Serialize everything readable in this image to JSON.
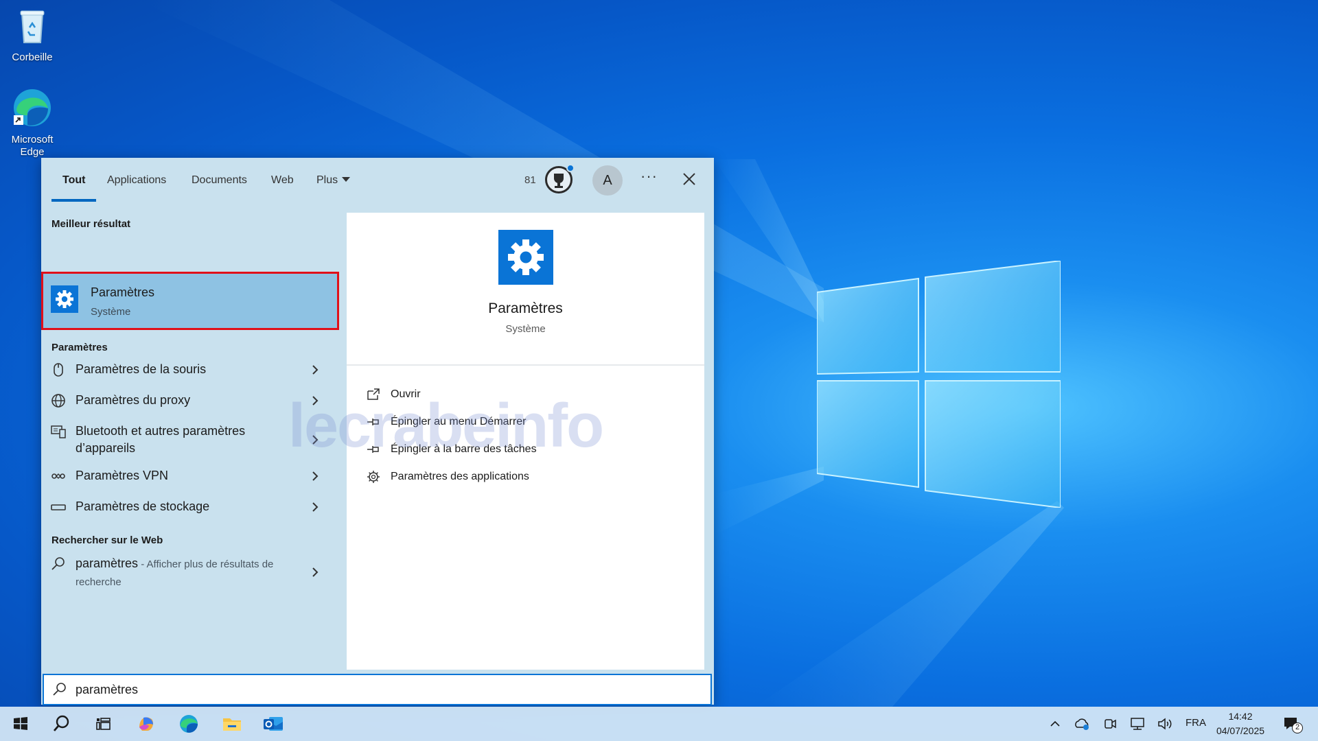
{
  "desktop": {
    "icons": [
      {
        "label": "Corbeille"
      },
      {
        "label": "Microsoft Edge"
      }
    ]
  },
  "search_panel": {
    "tabs": [
      "Tout",
      "Applications",
      "Documents",
      "Web",
      "Plus"
    ],
    "points": "81",
    "avatar_letter": "A",
    "more_label": "···",
    "best_match": {
      "section_title": "Meilleur résultat",
      "name": "Paramètres",
      "subtitle": "Système",
      "highlighted": true,
      "highlight_color": "#e0101a"
    },
    "settings_section": {
      "title": "Paramètres",
      "items": [
        {
          "label": "Paramètres de la souris",
          "icon": "mouse-icon"
        },
        {
          "label": "Paramètres du proxy",
          "icon": "globe-icon"
        },
        {
          "label": "Bluetooth et autres paramètres d’appareils",
          "icon": "devices-icon"
        },
        {
          "label": "Paramètres VPN",
          "icon": "vpn-icon"
        },
        {
          "label": "Paramètres de stockage",
          "icon": "storage-icon"
        }
      ]
    },
    "web_section": {
      "title": "Rechercher sur le Web",
      "query": "paramètres",
      "suffix": " - Afficher plus de résultats de recherche"
    },
    "preview": {
      "name": "Paramètres",
      "subtitle": "Système",
      "actions": [
        {
          "label": "Ouvrir",
          "icon": "open-icon"
        },
        {
          "label": "Épingler au menu Démarrer",
          "icon": "pin-icon"
        },
        {
          "label": "Épingler à la barre des tâches",
          "icon": "pin-icon"
        },
        {
          "label": "Paramètres des applications",
          "icon": "gear-icon"
        }
      ]
    },
    "search_box": {
      "value": "paramètres"
    },
    "watermark": "lecrabeinfo",
    "accent_color": "#0a74d6"
  },
  "taskbar": {
    "language": "FRA",
    "time": "14:42",
    "date": "04/07/2025",
    "notification_count": "2"
  }
}
